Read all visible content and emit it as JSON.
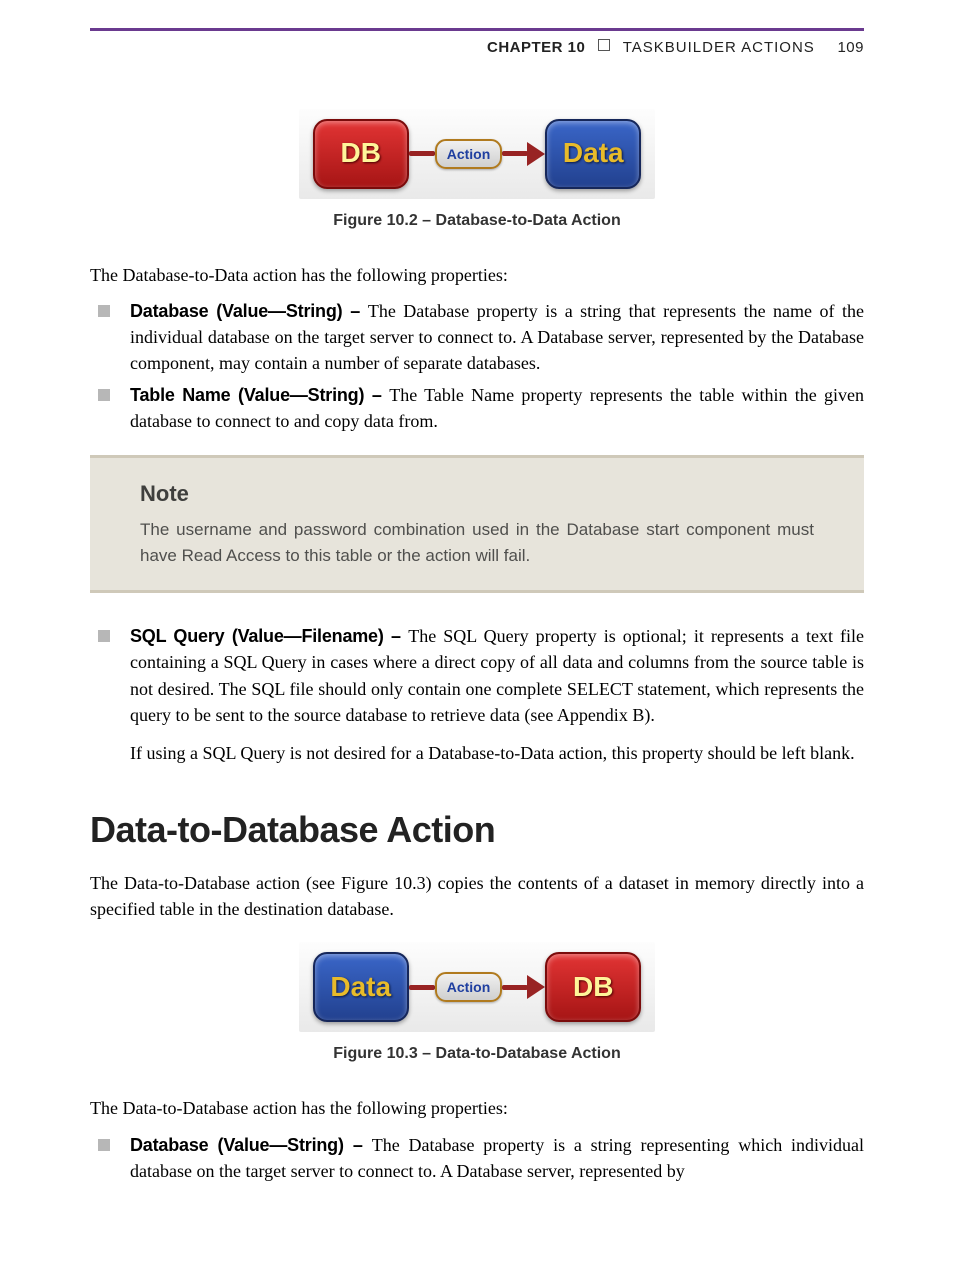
{
  "header": {
    "chapter_label": "CHAPTER 10",
    "chapter_title": "TASKBUILDER ACTIONS",
    "page_number": "109"
  },
  "fig1": {
    "left_label": "DB",
    "pill_label": "Action",
    "right_label": "Data",
    "caption": "Figure 10.2 – Database-to-Data Action"
  },
  "intro1": "The Database-to-Data action has the following properties:",
  "bullets1": {
    "b1_label": "Database (Value—String) – ",
    "b1_text": "The Database property is a string that represents the name of the individual database on the target server to connect to. A Database server, represented by the Database component, may contain a number of separate databases.",
    "b2_label": "Table Name (Value—String) – ",
    "b2_text": "The Table Name property represents the table within the given database to connect to and copy data from."
  },
  "note": {
    "title": "Note",
    "body": "The username and password combination used in the Database start component must have Read Access to this table or the action will fail."
  },
  "bullets2": {
    "b1_label": "SQL Query (Value—Filename) – ",
    "b1_text": "The SQL Query property is optional; it represents a text file containing a SQL Query in cases where a direct copy of all data and columns from the source table is not desired. The SQL file should only contain one complete SELECT statement, which represents the query to be sent to the source database to retrieve data (see Appendix B).",
    "b1_extra": "If using a SQL Query is not desired for a Database-to-Data action, this property should be left blank."
  },
  "section2": {
    "heading": "Data-to-Database Action",
    "intro": "The Data-to-Database action (see Figure 10.3) copies the contents of a dataset in memory directly into a specified table in the destination database."
  },
  "fig2": {
    "left_label": "Data",
    "pill_label": "Action",
    "right_label": "DB",
    "caption": "Figure 10.3 – Data-to-Database Action"
  },
  "intro2": "The Data-to-Database action has the following properties:",
  "bullets3": {
    "b1_label": "Database (Value—String) – ",
    "b1_text": "The Database property is a string representing which individual database on the target server to connect to. A Database server, represented by"
  }
}
